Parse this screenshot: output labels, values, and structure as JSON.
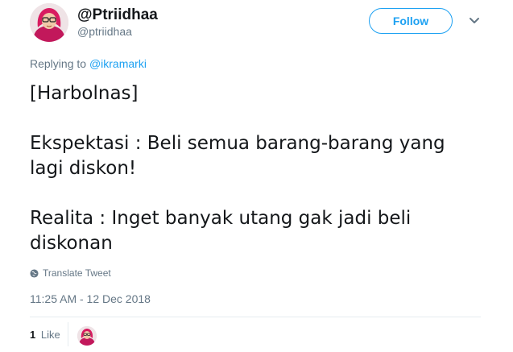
{
  "author": {
    "display_name": "@Ptriidhaa",
    "handle": "@ptriidhaa",
    "avatar_icon": "profile-avatar"
  },
  "follow_label": "Follow",
  "reply": {
    "prefix": "Replying to",
    "to": "@ikramarki"
  },
  "tweet": {
    "lines": [
      "[Harbolnas]",
      "Ekspektasi : Beli semua barang-barang yang lagi diskon!",
      "Realita : Inget banyak utang gak jadi beli diskonan"
    ]
  },
  "translate_label": "Translate Tweet",
  "timestamp": "11:25 AM - 12 Dec 2018",
  "likes": {
    "count": "1",
    "label": "Like"
  },
  "colors": {
    "accent": "#1da1f2",
    "secondary_text": "#657786",
    "primary_text": "#14171a",
    "divider": "#e6ecf0"
  }
}
